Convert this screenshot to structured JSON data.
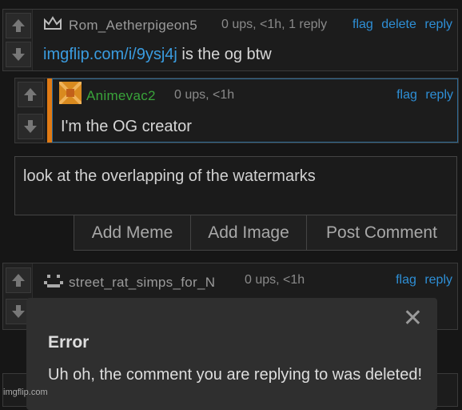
{
  "comment1": {
    "username": "Rom_Aetherpigeon5",
    "meta": "0 ups, <1h, 1 reply",
    "flag": "flag",
    "delete": "delete",
    "reply": "reply",
    "link": "imgflip.com/i/9ysj4j",
    "text_after_link": " is the og btw"
  },
  "comment2": {
    "username": "Animevac2",
    "meta": "0 ups, <1h",
    "flag": "flag",
    "reply": "reply",
    "text": "I'm the OG creator",
    "username_color": "#39a33a",
    "left_bar_color": "#e07a14"
  },
  "reply_box": {
    "value": "look at the overlapping of the watermarks",
    "buttons": [
      "Add Meme",
      "Add Image",
      "Post Comment"
    ]
  },
  "comment3": {
    "username": "street_rat_simps_for_N",
    "meta": "0 ups, <1h",
    "flag": "flag",
    "reply": "reply"
  },
  "modal": {
    "title": "Error",
    "message": "Uh oh, the comment you are replying to was deleted!",
    "close": "✕"
  },
  "watermark": "imgflip.com",
  "colors": {
    "link": "#2e8fd6",
    "background": "#161616"
  }
}
